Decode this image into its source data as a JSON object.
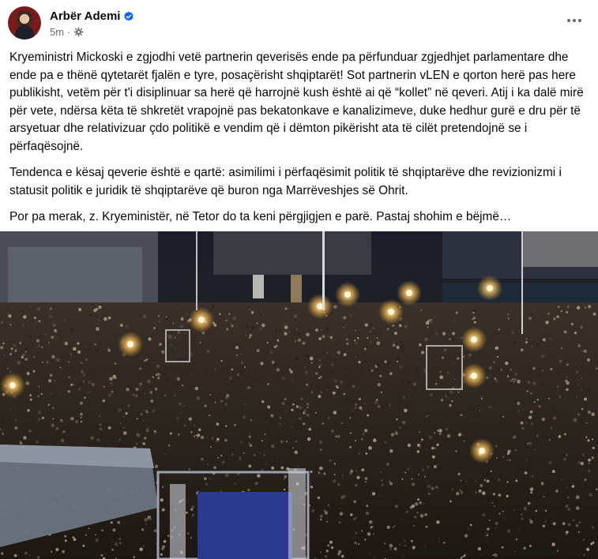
{
  "post": {
    "author": "Arbër Ademi",
    "time": "5m",
    "more_label": "More options",
    "paragraphs": [
      "Kryeministri Mickoski e zgjodhi vetë partnerin qeverisës ende pa përfunduar zgjedhjet parlamentare dhe ende pa e thënë qytetarët fjalën e tyre, posaçërisht shqiptarët! Sot partnerin vLEN e qorton herë pas here publikisht, vetëm për t'i disiplinuar sa herë që harrojnë kush është ai që “kollet” në qeveri. Atij i ka dalë mirë për vete, ndërsa këta të shkretët vrapojnë pas bekatonkave e kanalizimeve, duke hedhur gurë e dru për të arsyetuar dhe relativizuar çdo politikë e vendim që i dëmton pikërisht ata të cilët pretendojnë se i përfaqësojnë.",
      "Tendenca e kësaj qeverie është e qartë: asimilimi i përfaqësimit politik të shqiptarëve dhe revizionizmi i statusit politik e juridik të shqiptarëve që buron nga Marrëveshjes së Ohrit.",
      "Por pa merak, z. Kryeministër, në Tetor do ta keni përgjigjen e parë. Pastaj shohim e bëjmë…"
    ],
    "icons": {
      "verified": "verified-badge-icon",
      "privacy": "globe-gear-icon",
      "more": "more-options-icon"
    },
    "colors": {
      "verified": "#0866ff",
      "secondary_text": "#65676b"
    }
  }
}
